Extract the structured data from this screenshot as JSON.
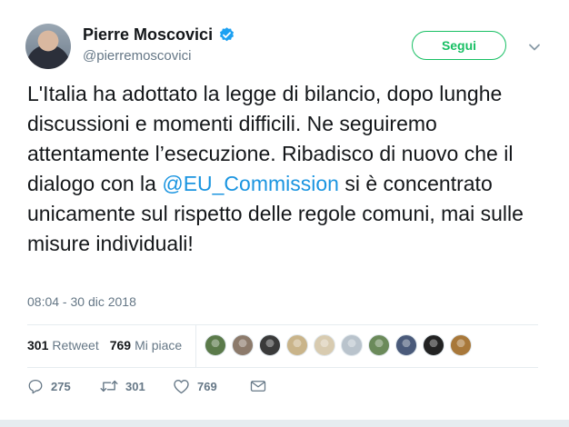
{
  "author": {
    "name": "Pierre Moscovici",
    "handle": "@pierremoscovici",
    "verified": true
  },
  "follow_button": {
    "label": "Segui"
  },
  "tweet": {
    "text_before": "L'Italia ha adottato la legge di bilancio, dopo lunghe discussioni e momenti difficili. Ne seguiremo attentamente l’esecuzione. Ribadisco di nuovo che il dialogo con la ",
    "mention": "@EU_Commission",
    "text_after": " si è concentrato unicamente sul rispetto delle regole comuni, mai sulle misure individuali!"
  },
  "timestamp": "08:04 - 30 dic 2018",
  "stats": {
    "retweets_count": "301",
    "retweets_label": "Retweet",
    "likes_count": "769",
    "likes_label": "Mi piace"
  },
  "liker_colors": [
    "#5b7a4a",
    "#8c7a6b",
    "#3a3a3a",
    "#c9b48a",
    "#d8cbb0",
    "#b9c3cc",
    "#6b8a5a",
    "#4a5a7a",
    "#222222",
    "#a8783a"
  ],
  "actions": {
    "replies": "275",
    "retweets": "301",
    "likes": "769"
  },
  "colors": {
    "accent_blue": "#1b95e0",
    "follow_green": "#17bf63",
    "muted": "#657786"
  }
}
